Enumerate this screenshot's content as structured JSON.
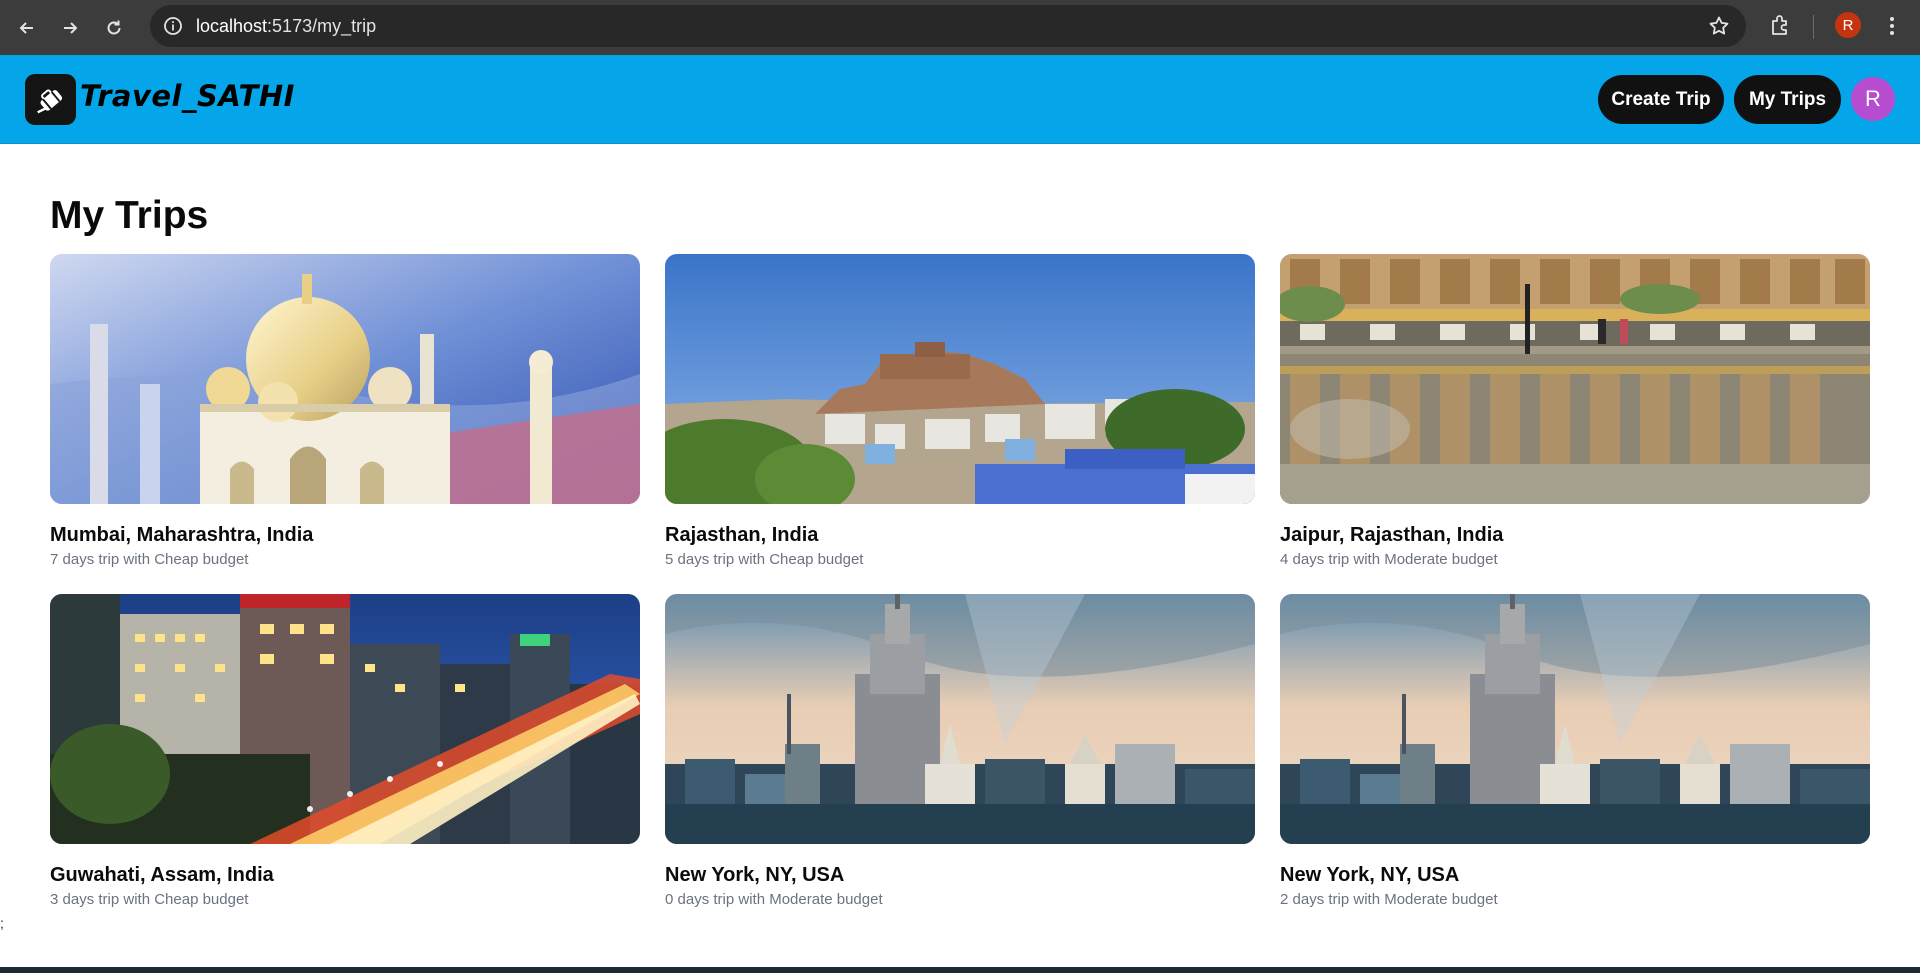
{
  "browser": {
    "url_host": "localhost",
    "url_rest": ":5173/my_trip",
    "profile_initial": "R"
  },
  "header": {
    "brand": "Travel_SATHI",
    "create_trip_label": "Create Trip",
    "my_trips_label": "My Trips",
    "avatar_initial": "R"
  },
  "main": {
    "title": "My Trips",
    "trips": [
      {
        "destination": "Mumbai, Maharashtra, India",
        "summary": "7 days trip with Cheap budget",
        "image": "taj-mahal"
      },
      {
        "destination": "Rajasthan, India",
        "summary": "5 days trip with Cheap budget",
        "image": "rajasthan-fort"
      },
      {
        "destination": "Jaipur, Rajasthan, India",
        "summary": "4 days trip with Moderate budget",
        "image": "jaipur-reflection"
      },
      {
        "destination": "Guwahati, Assam, India",
        "summary": "3 days trip with Cheap budget",
        "image": "guwahati-night"
      },
      {
        "destination": "New York, NY, USA",
        "summary": "0 days trip with Moderate budget",
        "image": "nyc-skyline"
      },
      {
        "destination": "New York, NY, USA",
        "summary": "2 days trip with Moderate budget",
        "image": "nyc-skyline"
      }
    ]
  },
  "stray_text": ";",
  "colors": {
    "header_bg": "#04a6e9",
    "button_bg": "#111111",
    "avatar_bg": "#b64dd1"
  }
}
